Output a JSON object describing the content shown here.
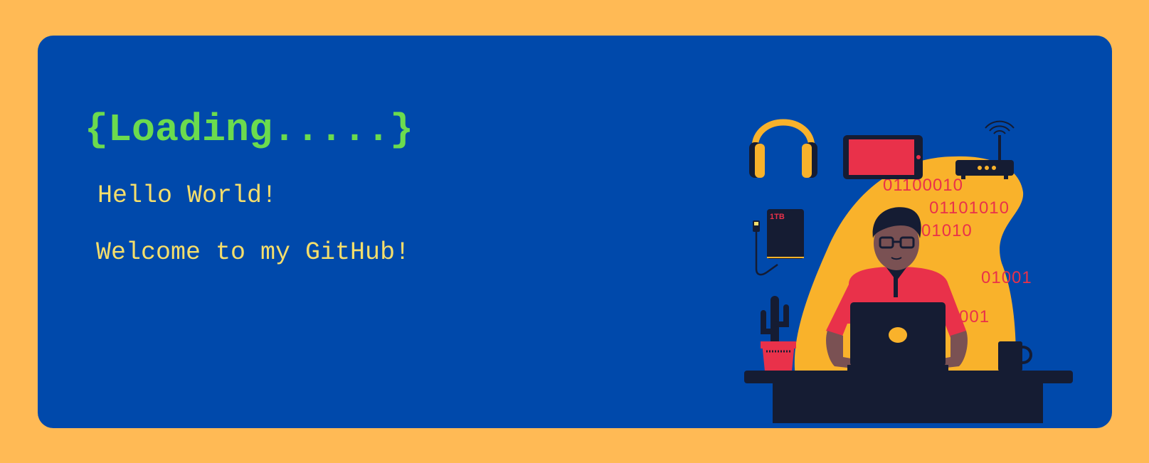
{
  "banner": {
    "headline": "{Loading.....}",
    "greeting": "Hello World!",
    "welcome": "Welcome to my GitHub!"
  },
  "illustration": {
    "binary": [
      "01100010",
      "01101010",
      "01010",
      "01001",
      "001"
    ],
    "drive_label": "1TB"
  },
  "colors": {
    "background": "#FFBA55",
    "card": "#0049AB",
    "headline": "#6BDB4E",
    "text": "#F5DE6B",
    "accent_red": "#E9314A",
    "accent_yellow": "#F9B22B",
    "dark": "#151C33"
  }
}
